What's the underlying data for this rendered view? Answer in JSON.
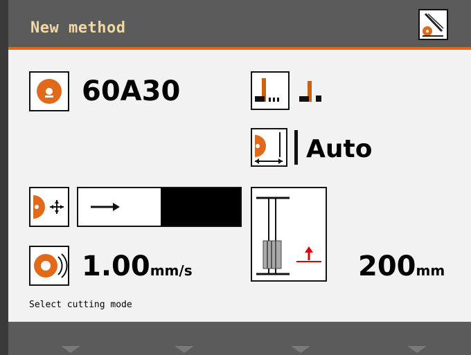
{
  "header": {
    "title": "New method"
  },
  "wheel": {
    "value": "60A30"
  },
  "feed_mode": {
    "value": "Auto"
  },
  "cutting_mode": {
    "fill_fraction": 0.49
  },
  "feed_speed": {
    "value": "1.00",
    "unit": "mm/s"
  },
  "cut_length": {
    "value": "200",
    "unit": "mm"
  },
  "status": {
    "text": "Select cutting mode"
  },
  "colors": {
    "accent": "#e06a1a",
    "title": "#f0d9a2",
    "header": "#5b5b5b",
    "red_arrow": "#e00000"
  }
}
